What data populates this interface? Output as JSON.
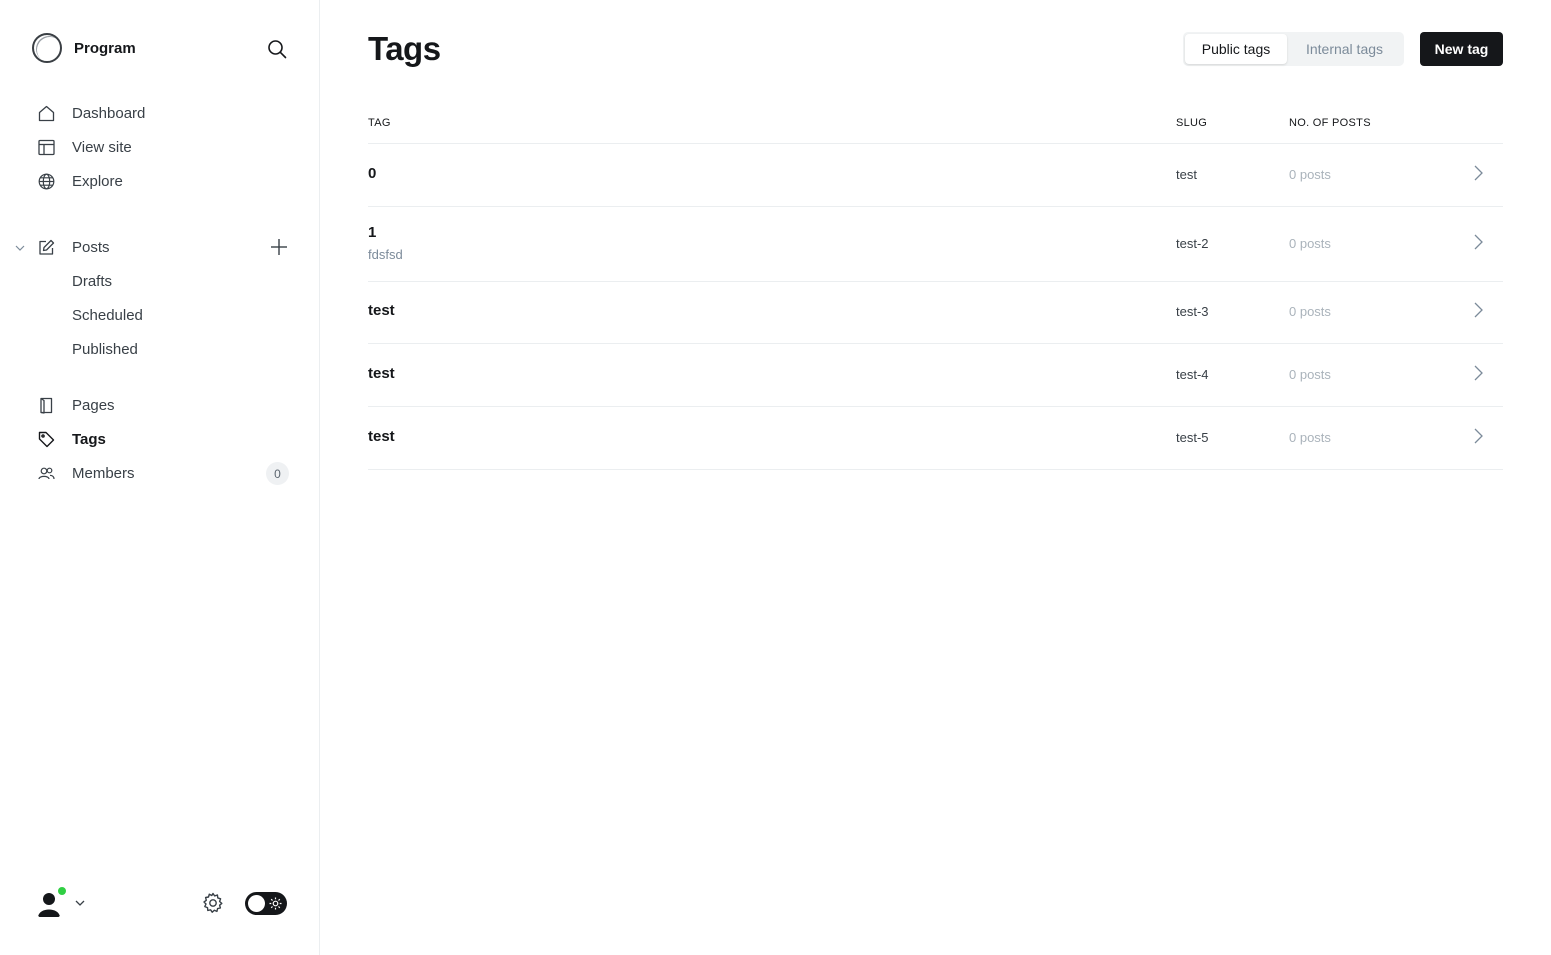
{
  "brand": {
    "name": "Program"
  },
  "sidebar": {
    "main_items": [
      {
        "label": "Dashboard",
        "icon": "home-icon"
      },
      {
        "label": "View site",
        "icon": "layout-icon"
      },
      {
        "label": "Explore",
        "icon": "globe-icon"
      }
    ],
    "posts": {
      "label": "Posts",
      "sub_items": [
        {
          "label": "Drafts"
        },
        {
          "label": "Scheduled"
        },
        {
          "label": "Published"
        }
      ]
    },
    "secondary_items": [
      {
        "label": "Pages",
        "icon": "page-icon"
      },
      {
        "label": "Tags",
        "icon": "tag-icon",
        "active": true
      },
      {
        "label": "Members",
        "icon": "members-icon",
        "count": "0"
      }
    ]
  },
  "header": {
    "title": "Tags",
    "public_tags_label": "Public tags",
    "internal_tags_label": "Internal tags",
    "new_tag_label": "New tag"
  },
  "table": {
    "columns": {
      "tag": "TAG",
      "slug": "SLUG",
      "posts": "NO. OF POSTS"
    },
    "rows": [
      {
        "name": "0",
        "description": "",
        "slug": "test",
        "posts": "0 posts"
      },
      {
        "name": "1",
        "description": "fdsfsd",
        "slug": "test-2",
        "posts": "0 posts"
      },
      {
        "name": "test",
        "description": "",
        "slug": "test-3",
        "posts": "0 posts"
      },
      {
        "name": "test",
        "description": "",
        "slug": "test-4",
        "posts": "0 posts"
      },
      {
        "name": "test",
        "description": "",
        "slug": "test-5",
        "posts": "0 posts"
      }
    ]
  },
  "colors": {
    "accent": "#15171a",
    "online": "#30cf43",
    "muted": "#7c8b9a",
    "border": "#ebeef0"
  }
}
